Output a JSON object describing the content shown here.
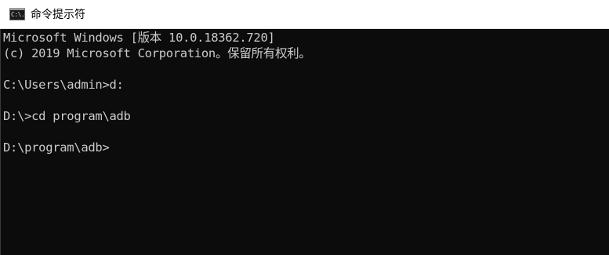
{
  "window": {
    "title": "命令提示符",
    "icon": "cmd-app-icon",
    "icon_glyph": "C:\\."
  },
  "console": {
    "lines": [
      "Microsoft Windows [版本 10.0.18362.720]",
      "(c) 2019 Microsoft Corporation。保留所有权利。",
      "",
      "C:\\Users\\admin>d:",
      "",
      "D:\\>cd program\\adb",
      "",
      "D:\\program\\adb>"
    ]
  },
  "colors": {
    "console_background": "#0c0c0c",
    "console_text": "#cccccc",
    "titlebar_background": "#ffffff"
  }
}
